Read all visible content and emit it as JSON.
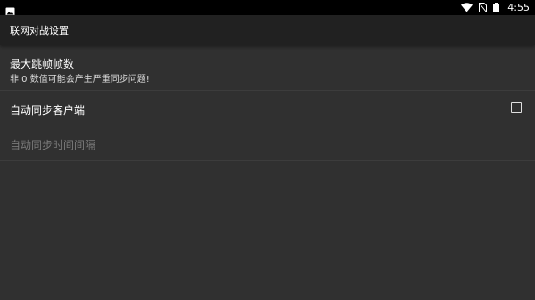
{
  "status_bar": {
    "time": "4:55",
    "icons": [
      "image-icon",
      "wifi-icon",
      "no-sim-icon",
      "battery-icon"
    ]
  },
  "toolbar": {
    "title": "联网对战设置"
  },
  "preferences": [
    {
      "title": "最大跳帧帧数",
      "summary": "非 0 数值可能会产生严重同步问题!"
    },
    {
      "title": "自动同步客户端",
      "checked": false
    },
    {
      "title": "自动同步时间间隔",
      "enabled": false
    }
  ],
  "colors": {
    "background": "#303030",
    "toolbar": "#212121",
    "status_bar": "#000000",
    "disabled_text": "#7a7a7a"
  }
}
